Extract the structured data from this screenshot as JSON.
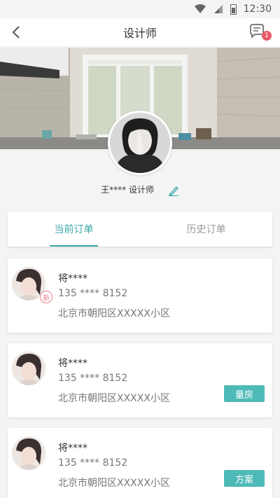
{
  "status_bar": {
    "time": "12:30"
  },
  "nav": {
    "title": "设计师",
    "message_badge": "1"
  },
  "designer": {
    "name_line": "王**** 设计师"
  },
  "tabs": [
    {
      "label": "当前订单",
      "active": true
    },
    {
      "label": "历史订单",
      "active": false
    }
  ],
  "orders": [
    {
      "name": "将****",
      "phone": "135 **** 8152",
      "address": "北京市朝阳区XXXXX小区",
      "tag": "新",
      "action": ""
    },
    {
      "name": "将****",
      "phone": "135 **** 8152",
      "address": "北京市朝阳区XXXXX小区",
      "tag": "",
      "action": "量房"
    },
    {
      "name": "将****",
      "phone": "135 **** 8152",
      "address": "北京市朝阳区XXXXX小区",
      "tag": "",
      "action": "方案"
    }
  ],
  "colors": {
    "accent": "#3aa7a8",
    "button": "#4dbab8",
    "badge": "#e85a6a"
  }
}
